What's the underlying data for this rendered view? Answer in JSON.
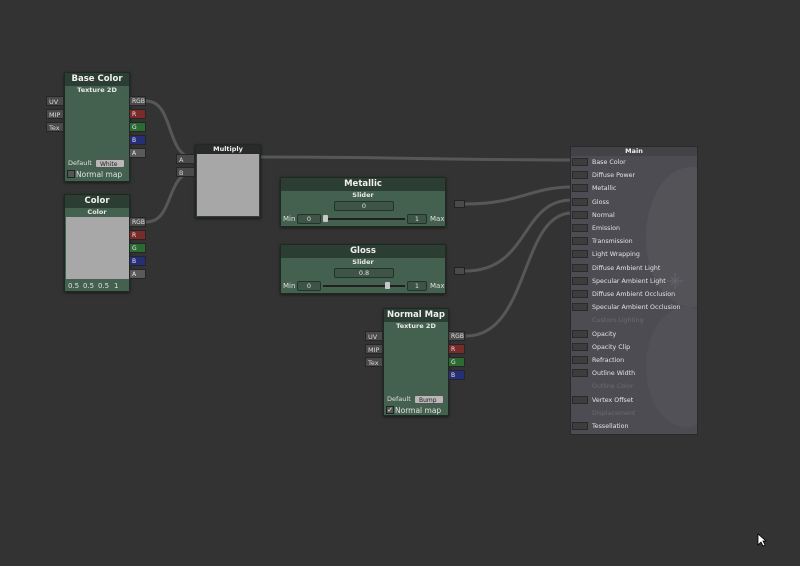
{
  "base_color_node": {
    "title": "Base Color",
    "subtitle": "Texture 2D",
    "inputs": [
      "UV",
      "MIP",
      "Tex"
    ],
    "outputs": [
      "RGB",
      "R",
      "G",
      "B",
      "A"
    ],
    "default_label": "Default",
    "default_value": "White",
    "normal_map_label": "Normal map"
  },
  "color_node": {
    "title": "Color",
    "subtitle": "Color",
    "outputs": [
      "RGB",
      "R",
      "G",
      "B",
      "A"
    ],
    "values": [
      "0.5",
      "0.5",
      "0.5",
      "1"
    ]
  },
  "multiply_node": {
    "title": "Multiply",
    "inputs": [
      "A",
      "B"
    ]
  },
  "metallic_node": {
    "title": "Metallic",
    "subtitle": "Slider",
    "value": "0",
    "min_label": "Min",
    "min_value": "0",
    "max_value": "1",
    "max_label": "Max",
    "slider_level": 0.0
  },
  "gloss_node": {
    "title": "Gloss",
    "subtitle": "Slider",
    "value": "0.8",
    "min_label": "Min",
    "min_value": "0",
    "max_value": "1",
    "max_label": "Max",
    "slider_level": 0.8
  },
  "normal_map_node": {
    "title": "Normal Map",
    "subtitle": "Texture 2D",
    "inputs": [
      "UV",
      "MIP",
      "Tex"
    ],
    "outputs": [
      "RGB",
      "R",
      "G",
      "B"
    ],
    "default_label": "Default",
    "default_value": "Bump",
    "normal_map_label": "Normal map",
    "normal_map_checked": true
  },
  "main_node": {
    "title": "Main",
    "inputs": [
      {
        "label": "Base Color",
        "enabled": true
      },
      {
        "label": "Diffuse Power",
        "enabled": true
      },
      {
        "label": "Metallic",
        "enabled": true
      },
      {
        "label": "Gloss",
        "enabled": true
      },
      {
        "label": "Normal",
        "enabled": true
      },
      {
        "label": "Emission",
        "enabled": true
      },
      {
        "label": "Transmission",
        "enabled": true
      },
      {
        "label": "Light Wrapping",
        "enabled": true
      },
      {
        "label": "Diffuse Ambient Light",
        "enabled": true
      },
      {
        "label": "Specular Ambient Light",
        "enabled": true
      },
      {
        "label": "Diffuse Ambient Occlusion",
        "enabled": true
      },
      {
        "label": "Specular Ambient Occlusion",
        "enabled": true
      },
      {
        "label": "Custom Lighting",
        "enabled": false
      },
      {
        "label": "Opacity",
        "enabled": true
      },
      {
        "label": "Opacity Clip",
        "enabled": true
      },
      {
        "label": "Refraction",
        "enabled": true
      },
      {
        "label": "Outline Width",
        "enabled": true
      },
      {
        "label": "Outline Color",
        "enabled": false
      },
      {
        "label": "Vertex Offset",
        "enabled": true
      },
      {
        "label": "Displacement",
        "enabled": false
      },
      {
        "label": "Tessellation",
        "enabled": true
      }
    ]
  },
  "colors": {
    "canvas": "#333333",
    "node_body": "#44604f",
    "node_header": "#2c3e33",
    "wire": "#5a5a5a",
    "main_panel": "#4c4c52"
  }
}
